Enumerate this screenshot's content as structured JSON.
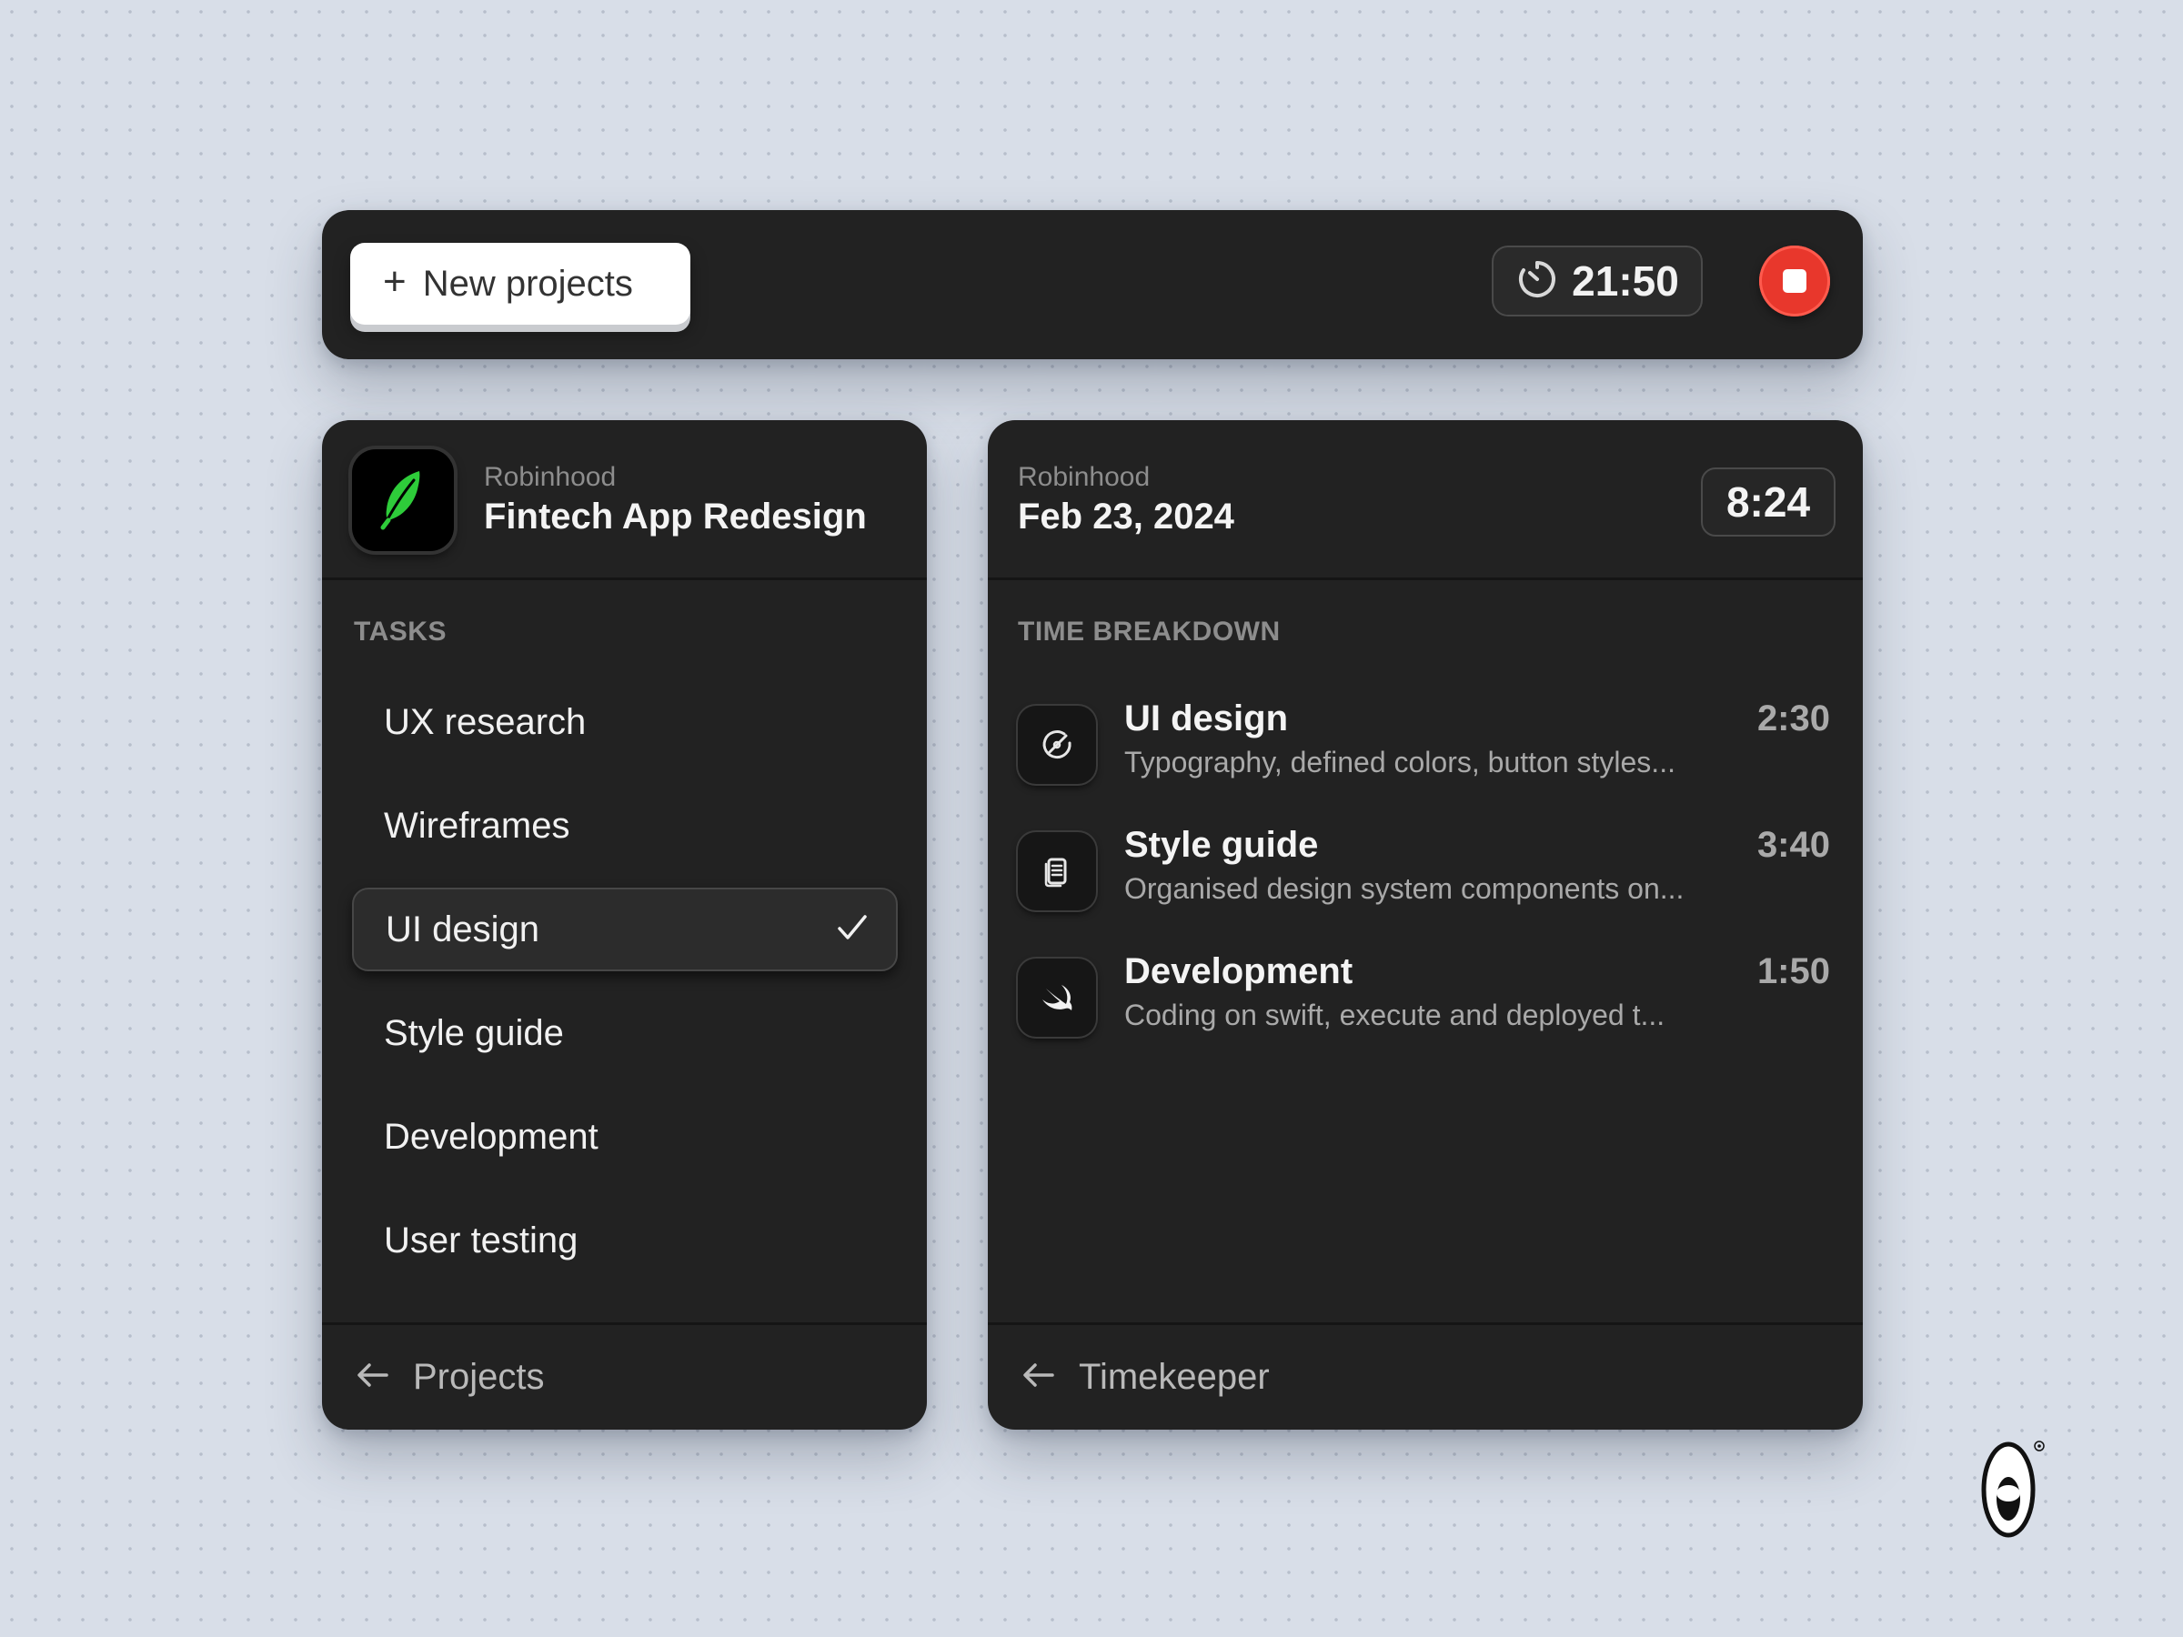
{
  "topbar": {
    "new_button_label": "New projects",
    "timer_value": "21:50",
    "stop_color": "#e8372c"
  },
  "project_panel": {
    "client": "Robinhood",
    "project_name": "Fintech App Redesign",
    "icon": "feather-icon",
    "icon_color": "#2ecc3a",
    "section_label": "TASKS",
    "tasks": [
      {
        "label": "UX research",
        "selected": false
      },
      {
        "label": "Wireframes",
        "selected": false
      },
      {
        "label": "UI design",
        "selected": true
      },
      {
        "label": "Style guide",
        "selected": false
      },
      {
        "label": "Development",
        "selected": false
      },
      {
        "label": "User testing",
        "selected": false
      }
    ],
    "footer_label": "Projects"
  },
  "timekeeper_panel": {
    "client": "Robinhood",
    "date": "Feb 23, 2024",
    "total_time": "8:24",
    "section_label": "TIME BREAKDOWN",
    "entries": [
      {
        "name": "UI design",
        "description": "Typography, defined colors, button styles...",
        "time": "2:30",
        "icon": "design-tool-icon"
      },
      {
        "name": "Style guide",
        "description": "Organised design system components on...",
        "time": "3:40",
        "icon": "document-icon"
      },
      {
        "name": "Development",
        "description": "Coding on swift, execute and  deployed t...",
        "time": "1:50",
        "icon": "swift-icon"
      }
    ],
    "footer_label": "Timekeeper"
  }
}
